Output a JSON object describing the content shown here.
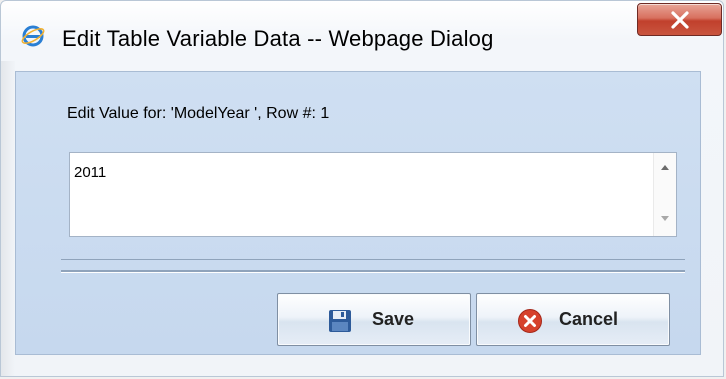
{
  "window": {
    "title": "Edit Table Variable Data -- Webpage Dialog",
    "close_symbol": "X"
  },
  "dialog": {
    "edit_label": "Edit Value for: 'ModelYear ', Row #: 1",
    "value_text": "2011"
  },
  "buttons": {
    "save_label": "Save",
    "cancel_label": "Cancel"
  },
  "icons": {
    "title": "ie-icon",
    "close": "close-icon",
    "save": "floppy-disk-icon",
    "cancel": "cancel-x-icon",
    "scroll_up": "scroll-up-arrow-icon",
    "scroll_down": "scroll-down-arrow-icon"
  },
  "colors": {
    "content_bg": "#c9dbef",
    "close_button": "#c94a35",
    "cancel_icon": "#d6412c",
    "save_icon": "#2e5b9a"
  }
}
